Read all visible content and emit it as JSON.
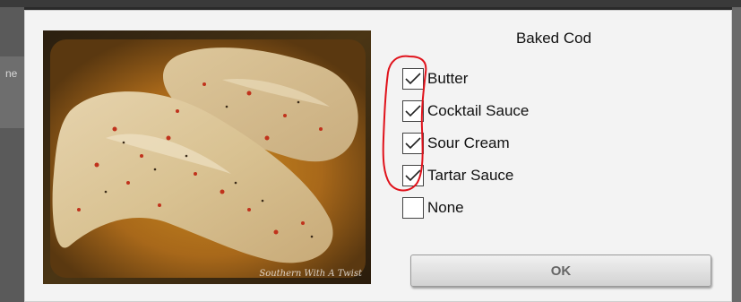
{
  "background": {
    "left_label": "ne"
  },
  "dialog": {
    "title": "Baked Cod",
    "photo": {
      "subject": "baked cod fillets",
      "watermark": "Southern With A Twist"
    },
    "options": [
      {
        "label": "Butter",
        "checked": true
      },
      {
        "label": "Cocktail Sauce",
        "checked": true
      },
      {
        "label": "Sour Cream",
        "checked": true
      },
      {
        "label": "Tartar Sauce",
        "checked": true
      },
      {
        "label": "None",
        "checked": false
      }
    ],
    "ok_label": "OK"
  },
  "annotation": {
    "color": "#e0121b",
    "shape": "hand-drawn-loop"
  },
  "colors": {
    "dialog_bg": "#f3f3f3",
    "button_text": "#666666"
  }
}
